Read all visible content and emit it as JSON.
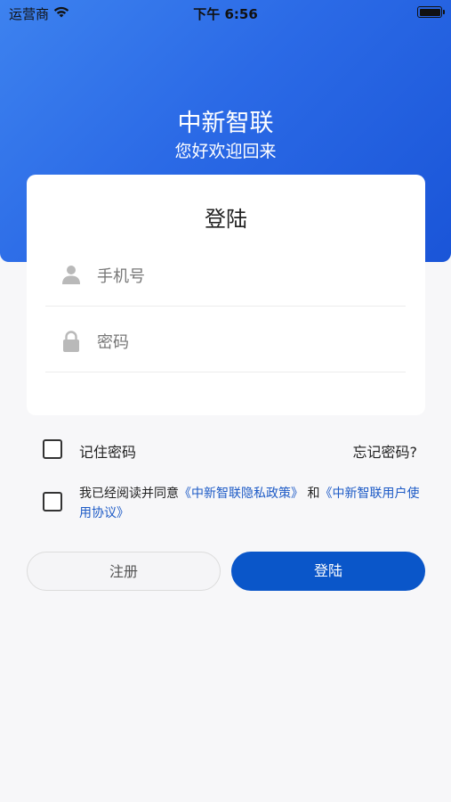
{
  "status_bar": {
    "carrier": "运营商",
    "time": "下午 6:56"
  },
  "header": {
    "app_name": "中新智联",
    "greeting": "您好欢迎回来"
  },
  "login_card": {
    "title": "登陆",
    "phone_placeholder": "手机号",
    "password_placeholder": "密码"
  },
  "options": {
    "remember_label": "记住密码",
    "forgot_label": "忘记密码?",
    "agree_prefix": "我已经阅读并同意",
    "privacy_link": "《中新智联隐私政策》",
    "and_text": "和",
    "terms_link": "《中新智联用户使用协议》"
  },
  "buttons": {
    "register": "注册",
    "login": "登陆"
  },
  "colors": {
    "header_gradient_start": "#3d82ef",
    "header_gradient_end": "#1a55d8",
    "primary_button": "#0a56c9",
    "link": "#1e5bc6"
  },
  "icons": {
    "phone_field": "user-icon",
    "password_field": "lock-icon"
  }
}
